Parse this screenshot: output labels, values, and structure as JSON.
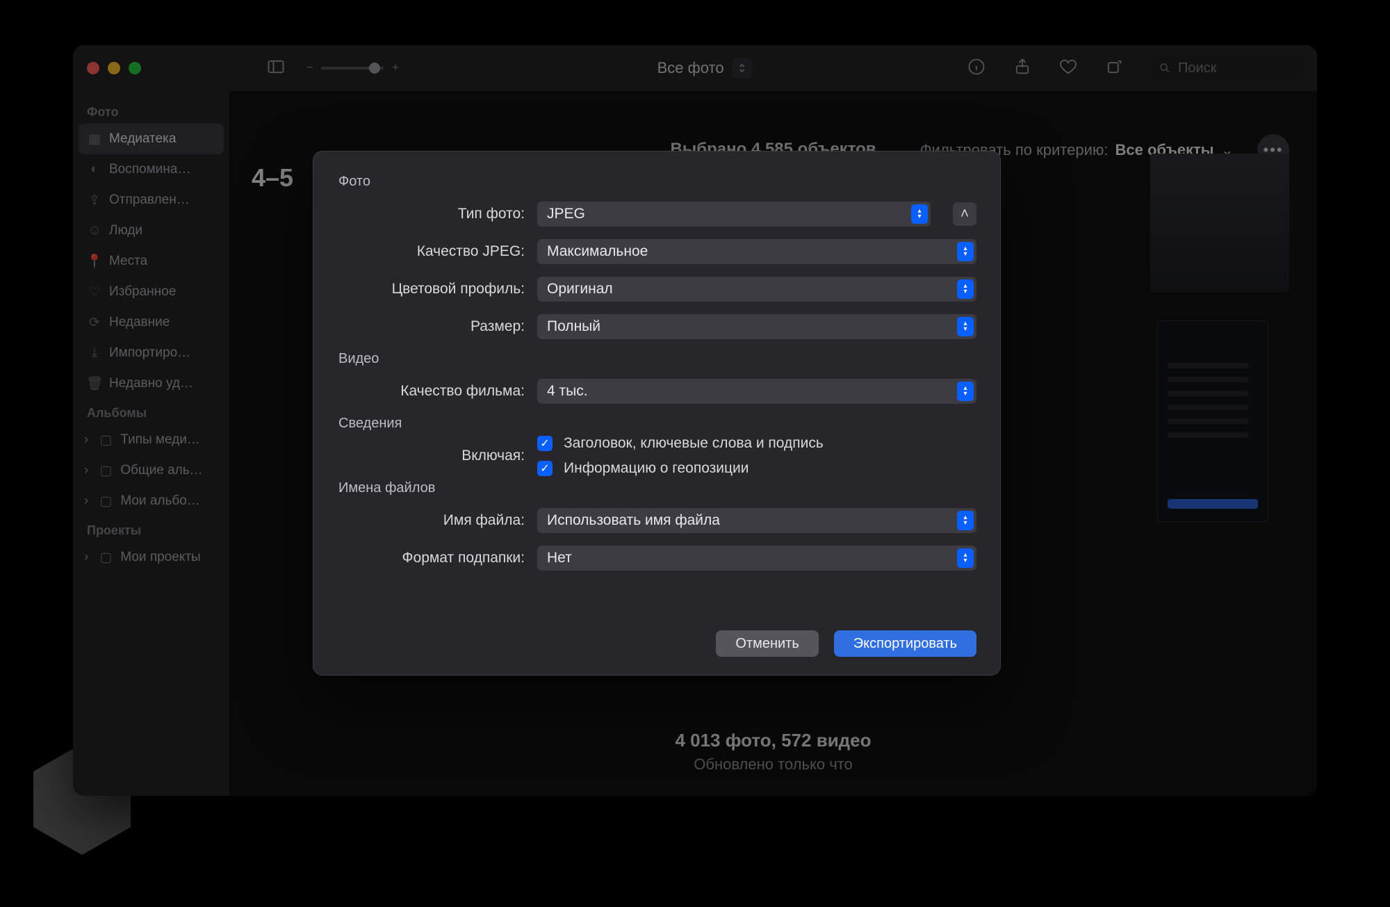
{
  "toolbar": {
    "view_popup": "Все фото",
    "search_placeholder": "Поиск"
  },
  "sidebar": {
    "sections": [
      {
        "title": "Фото",
        "items": [
          {
            "icon": "library-icon",
            "label": "Медиатека",
            "selected": true
          },
          {
            "icon": "memories-icon",
            "label": "Воспомина…"
          },
          {
            "icon": "shared-icon",
            "label": "Отправлен…"
          },
          {
            "icon": "people-icon",
            "label": "Люди"
          },
          {
            "icon": "places-icon",
            "label": "Места"
          },
          {
            "icon": "favorites-icon",
            "label": "Избранное"
          },
          {
            "icon": "recent-icon",
            "label": "Недавние"
          },
          {
            "icon": "import-icon",
            "label": "Импортиро…"
          },
          {
            "icon": "trash-icon",
            "label": "Недавно уд…"
          }
        ]
      },
      {
        "title": "Альбомы",
        "items": [
          {
            "icon": "folder-icon",
            "label": "Типы меди…",
            "disclosure": true
          },
          {
            "icon": "folder-icon",
            "label": "Общие аль…",
            "disclosure": true
          },
          {
            "icon": "folder-icon",
            "label": "Мои альбо…",
            "disclosure": true
          }
        ]
      },
      {
        "title": "Проекты",
        "items": [
          {
            "icon": "folder-icon",
            "label": "Мои проекты",
            "disclosure": true
          }
        ]
      }
    ]
  },
  "content": {
    "date_heading_prefix": "4–5",
    "selection": "Выбрано 4 585 объектов",
    "filter_label": "Фильтровать по критерию:",
    "filter_value": "Все объекты",
    "footer_count": "4 013 фото, 572 видео",
    "footer_updated": "Обновлено только что"
  },
  "dialog": {
    "sections": {
      "photo": "Фото",
      "video": "Видео",
      "info": "Сведения",
      "filenames": "Имена файлов"
    },
    "labels": {
      "photo_kind": "Тип фото:",
      "jpeg_quality": "Качество JPEG:",
      "color_profile": "Цветовой профиль:",
      "size": "Размер:",
      "movie_quality": "Качество фильма:",
      "include": "Включая:",
      "file_name": "Имя файла:",
      "subfolder_format": "Формат подпапки:"
    },
    "values": {
      "photo_kind": "JPEG",
      "jpeg_quality": "Максимальное",
      "color_profile": "Оригинал",
      "size": "Полный",
      "movie_quality": "4 тыс.",
      "include_title": "Заголовок, ключевые слова и подпись",
      "include_location": "Информацию о геопозиции",
      "file_name": "Использовать имя файла",
      "subfolder_format": "Нет"
    },
    "buttons": {
      "cancel": "Отменить",
      "export": "Экспортировать"
    }
  }
}
